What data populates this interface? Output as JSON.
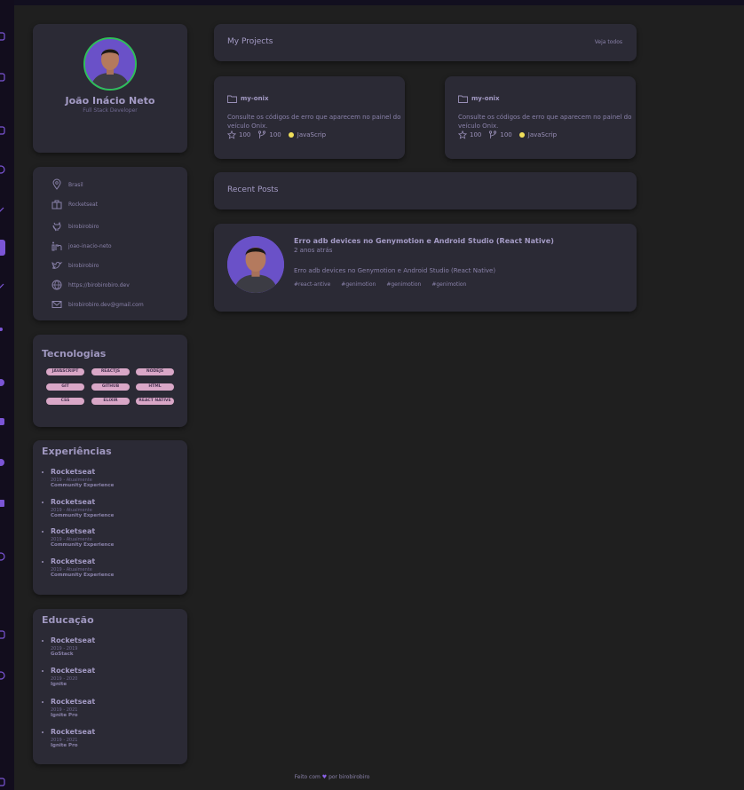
{
  "profile": {
    "name": "João Inácio Neto",
    "role": "Full Stack Developer"
  },
  "info": [
    {
      "icon": "map-pin-icon",
      "text": "Brasil"
    },
    {
      "icon": "briefcase-icon",
      "text": "Rocketseat"
    },
    {
      "icon": "github-icon",
      "text": "birobirobiro"
    },
    {
      "icon": "linkedin-icon",
      "text": "joao-inacio-neto"
    },
    {
      "icon": "twitter-icon",
      "text": "birobirobiro"
    },
    {
      "icon": "globe-icon",
      "text": "https://birobirobiro.dev"
    },
    {
      "icon": "mail-icon",
      "text": "birobirobiro.dev@gmail.com"
    }
  ],
  "technologies": {
    "title": "Tecnologias",
    "tags": [
      "JAVASCRIPT",
      "REACTJS",
      "NODEJS",
      "GIT",
      "GITHUB",
      "HTML",
      "CSS",
      "ELIXIR",
      "REACT NATIVE"
    ]
  },
  "experiences": {
    "title": "Experiências",
    "items": [
      {
        "org": "Rocketseat",
        "period": "2019 - Atualmente",
        "role": "Community Experience"
      },
      {
        "org": "Rocketseat",
        "period": "2019 - Atualmente",
        "role": "Community Experience"
      },
      {
        "org": "Rocketseat",
        "period": "2019 - Atualmente",
        "role": "Community Experience"
      },
      {
        "org": "Rocketseat",
        "period": "2019 - Atualmente",
        "role": "Community Experience"
      }
    ]
  },
  "education": {
    "title": "Educação",
    "items": [
      {
        "org": "Rocketseat",
        "period": "2019 - 2019",
        "role": "GoStack"
      },
      {
        "org": "Rocketseat",
        "period": "2019 - 2020",
        "role": "Ignite"
      },
      {
        "org": "Rocketseat",
        "period": "2019 - 2021",
        "role": "Ignite Pro"
      },
      {
        "org": "Rocketseat",
        "period": "2019 - 2021",
        "role": "Ignite Pro"
      }
    ]
  },
  "projects": {
    "title": "My Projects",
    "see_all": "Veja todos",
    "items": [
      {
        "name": "my-onix",
        "description": "Consulte os códigos de erro que aparecem no painel do veículo Onix.",
        "stars": "100",
        "forks": "100",
        "language": "JavaScrip"
      },
      {
        "name": "my-onix",
        "description": "Consulte os códigos de erro que aparecem no painel do veículo Onix.",
        "stars": "100",
        "forks": "100",
        "language": "JavaScrip"
      }
    ]
  },
  "posts": {
    "title": "Recent Posts",
    "items": [
      {
        "title": "Erro adb devices no Genymotion e Android Studio (React Native)",
        "time": "2 anos atrás",
        "summary": "Erro adb devices no Genymotion e Android Studio (React Native)",
        "tags": [
          "#react-antive",
          "#genimotion",
          "#genimotion",
          "#genimotion"
        ]
      }
    ]
  },
  "footer": {
    "prefix": "Feito com",
    "suffix": "por birobirobiro"
  },
  "colors": {
    "background": "#1f1f1f",
    "panel": "#2b2a35",
    "accent": "#8a62e6",
    "avatar_ring": "#2fbf59",
    "tag": "#d9a7c7",
    "language_dot": "#f1e05a"
  }
}
